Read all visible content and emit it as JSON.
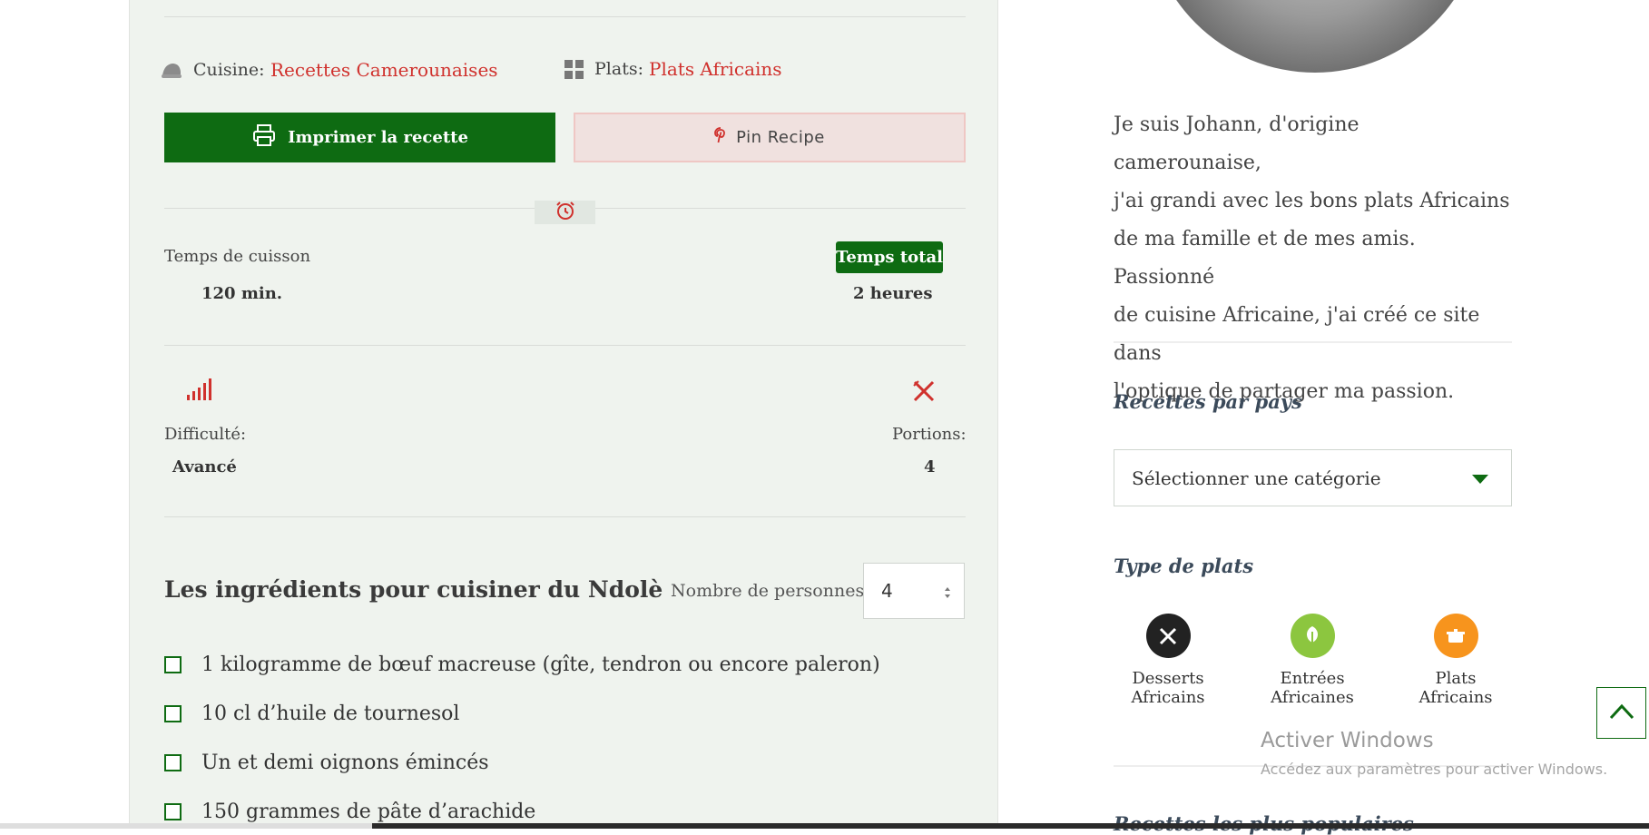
{
  "recipe_meta": {
    "cuisine_label": "Cuisine:",
    "cuisine_value": "Recettes Camerounaises",
    "plats_label": "Plats:",
    "plats_value": "Plats Africains"
  },
  "buttons": {
    "print_label": "Imprimer la recette",
    "pin_label": "Pin Recipe"
  },
  "times": {
    "cook_label": "Temps de cuisson",
    "cook_value": "120 min.",
    "total_label": "Temps total",
    "total_value": "2 heures"
  },
  "details": {
    "difficulty_label": "Difficulté:",
    "difficulty_value": "Avancé",
    "portions_label": "Portions:",
    "portions_value": "4"
  },
  "ingredients": {
    "title": "Les ingrédients pour cuisiner du Ndolè",
    "persons_label": "Nombre de personnes",
    "persons_value": "4",
    "items": [
      "1 kilogramme de bœuf macreuse (gîte, tendron ou encore paleron)",
      "10 cl d’huile de tournesol",
      "Un et demi oignons émincés",
      "150 grammes de pâte d’arachide"
    ]
  },
  "sidebar": {
    "bio": "Je suis Johann, d'origine camerounaise, j'ai grandi avec les bons plats Africains de ma famille et de mes amis. Passionné de cuisine Africaine, j'ai créé ce site dans l'optique de partager ma passion.",
    "bio_lines": [
      "Je suis Johann, d'origine camerounaise,",
      "j'ai grandi avec les bons plats Africains",
      "de ma famille et de mes amis. Passionné",
      "de cuisine Africaine, j'ai créé ce site dans",
      "l'optique de partager ma passion."
    ],
    "countries_title": "Recettes par pays",
    "select_placeholder": "Sélectionner une catégorie",
    "types_title": "Type de plats",
    "categories": [
      {
        "line1": "Desserts",
        "line2": "Africains",
        "color": "#222222",
        "icon": "fork-knife-icon"
      },
      {
        "line1": "Entrées",
        "line2": "Africaines",
        "color": "#8cc63f",
        "icon": "leaf-icon"
      },
      {
        "line1": "Plats",
        "line2": "Africains",
        "color": "#f7941d",
        "icon": "pot-icon"
      }
    ],
    "popular_title": "Recettes les plus populaires"
  },
  "windows_watermark": {
    "line1": "Activer Windows",
    "line2": "Accédez aux paramètres pour activer Windows."
  },
  "colors": {
    "brand_green": "#0e6b12",
    "accent_red": "#d0312d",
    "card_bg": "#eff3ee"
  }
}
